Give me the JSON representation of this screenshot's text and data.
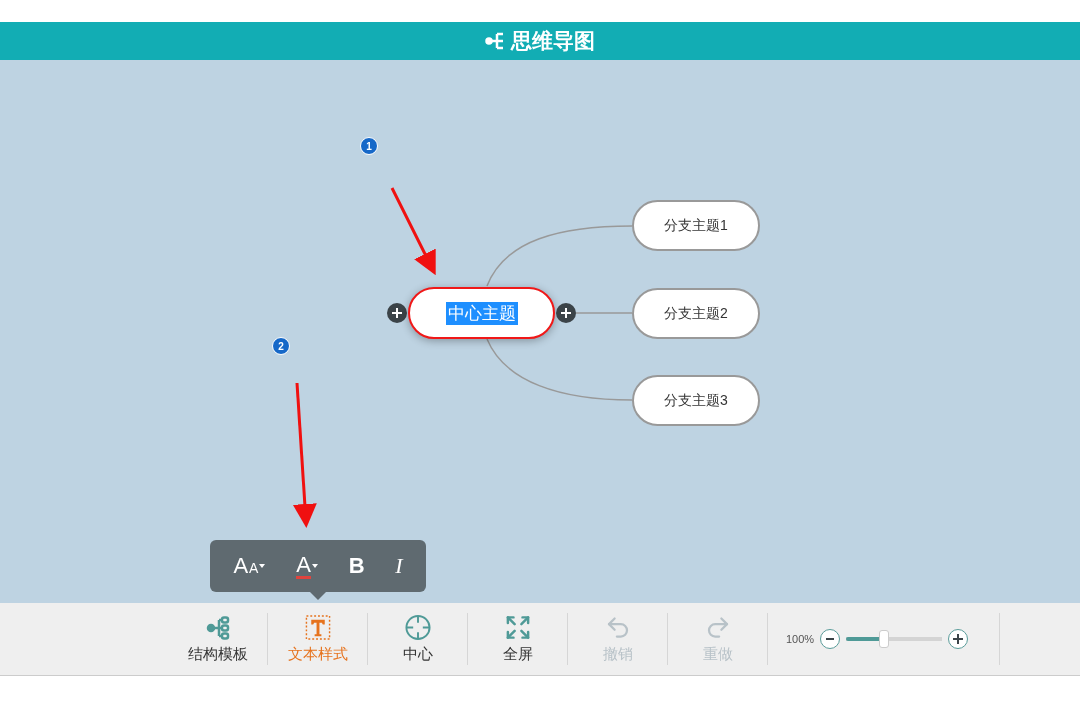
{
  "header": {
    "title": "思维导图"
  },
  "map": {
    "center": {
      "text": "中心主题",
      "selected": true,
      "text_selected": true
    },
    "branches": [
      {
        "text": "分支主题1"
      },
      {
        "text": "分支主题2"
      },
      {
        "text": "分支主题3"
      }
    ],
    "annotations": [
      {
        "number": "1"
      },
      {
        "number": "2"
      }
    ]
  },
  "format_popup": {
    "buttons": [
      {
        "kind": "size",
        "text": "A",
        "small": "A"
      },
      {
        "kind": "color",
        "text": "A",
        "color": "#e0443e"
      },
      {
        "kind": "bold",
        "text": "B"
      },
      {
        "kind": "italic",
        "text": "I"
      }
    ]
  },
  "toolbar": {
    "items": [
      {
        "kind": "structure",
        "label": "结构模板",
        "selected": false,
        "disabled": false
      },
      {
        "kind": "text",
        "label": "文本样式",
        "selected": true,
        "disabled": false
      },
      {
        "kind": "center",
        "label": "中心",
        "selected": false,
        "disabled": false
      },
      {
        "kind": "fullscreen",
        "label": "全屏",
        "selected": false,
        "disabled": false
      },
      {
        "kind": "undo",
        "label": "撤销",
        "selected": false,
        "disabled": true
      },
      {
        "kind": "redo",
        "label": "重做",
        "selected": false,
        "disabled": true
      }
    ],
    "zoom": {
      "label": "100%",
      "level": 0.39
    }
  }
}
